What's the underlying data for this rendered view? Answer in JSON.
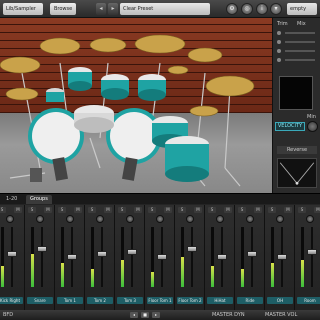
{
  "topbar": {
    "instrument_menu": "Lib/Sampler",
    "browse_button": "Browse",
    "preset_name": "Clear Preset",
    "slot_name": "empty",
    "prev_label": "◂",
    "next_label": "▸"
  },
  "right_panel": {
    "trim_label": "Trim",
    "mix_label": "Mix",
    "velocity_label": "VELOCITY",
    "min_label": "Min",
    "reverse_label": "Reverse"
  },
  "mixer": {
    "tabs": [
      "1-20",
      "Groups"
    ],
    "solo_label": "S",
    "mute_label": "M",
    "channels": [
      {
        "name": "Kick Right",
        "level": 0.35,
        "fader": 0.45
      },
      {
        "name": "Snare",
        "level": 0.55,
        "fader": 0.35
      },
      {
        "name": "Tom 1",
        "level": 0.4,
        "fader": 0.5
      },
      {
        "name": "Tom 2",
        "level": 0.3,
        "fader": 0.45
      },
      {
        "name": "Tom 3",
        "level": 0.45,
        "fader": 0.4
      },
      {
        "name": "Floor Tom 1",
        "level": 0.25,
        "fader": 0.5
      },
      {
        "name": "Floor Tom 2",
        "level": 0.5,
        "fader": 0.35
      },
      {
        "name": "HiHat",
        "level": 0.35,
        "fader": 0.5
      },
      {
        "name": "Ride",
        "level": 0.3,
        "fader": 0.45
      },
      {
        "name": "OH",
        "level": 0.4,
        "fader": 0.5
      },
      {
        "name": "Room",
        "level": 0.45,
        "fader": 0.4
      }
    ]
  },
  "bottombar": {
    "brand": "BFD",
    "master_dyn": "MASTER DYN",
    "master_vol": "MASTER VOL"
  },
  "colors": {
    "accent": "#3aa9b9",
    "drum_shell": "#1fa3a3",
    "brick": "#7a3018"
  }
}
